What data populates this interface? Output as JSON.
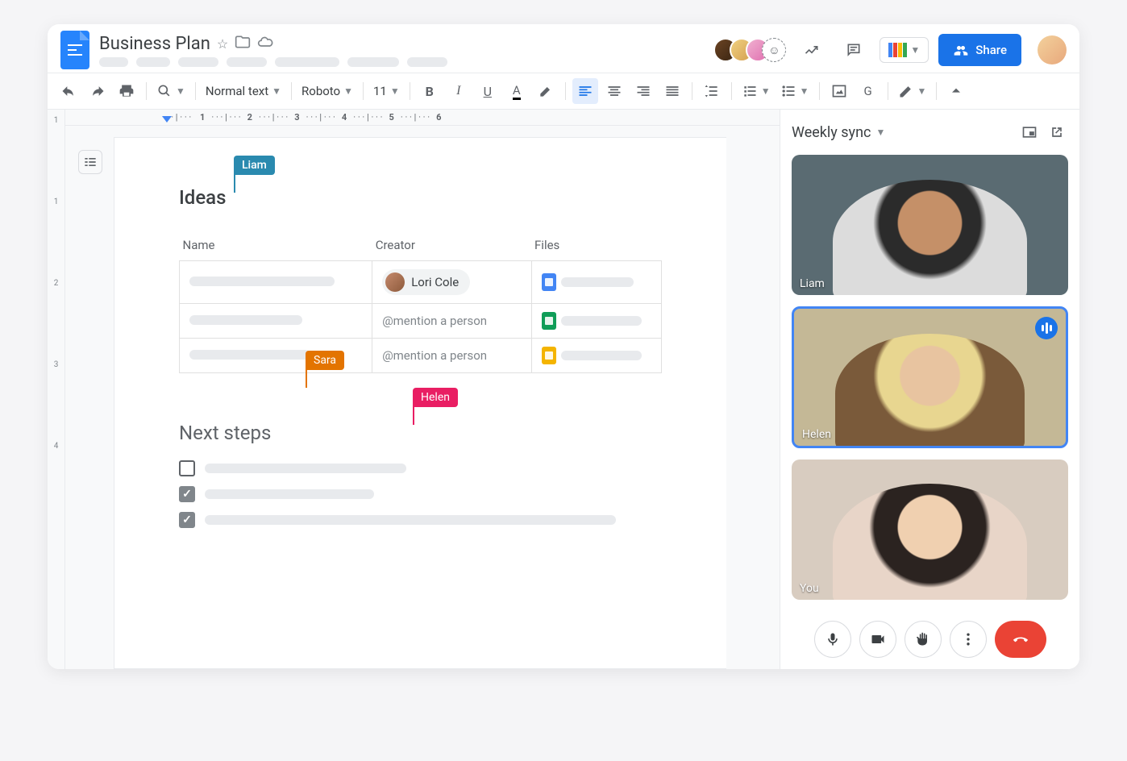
{
  "header": {
    "doc_title": "Business Plan",
    "share_label": "Share"
  },
  "toolbar": {
    "style": "Normal text",
    "font": "Roboto",
    "size": "11"
  },
  "ruler_numbers": [
    "1",
    "2",
    "3",
    "4",
    "5",
    "6"
  ],
  "ruler_v": [
    "1",
    "1",
    "2",
    "3",
    "4"
  ],
  "document": {
    "ideas_heading": "Ideas",
    "columns": {
      "name": "Name",
      "creator": "Creator",
      "files": "Files"
    },
    "mention_placeholder": "@mention a person",
    "creator_chip": "Lori Cole",
    "next_heading": "Next steps"
  },
  "cursors": {
    "liam": "Liam",
    "sara": "Sara",
    "helen": "Helen"
  },
  "meet": {
    "title": "Weekly sync",
    "tiles": {
      "liam": "Liam",
      "helen": "Helen",
      "you": "You"
    }
  }
}
